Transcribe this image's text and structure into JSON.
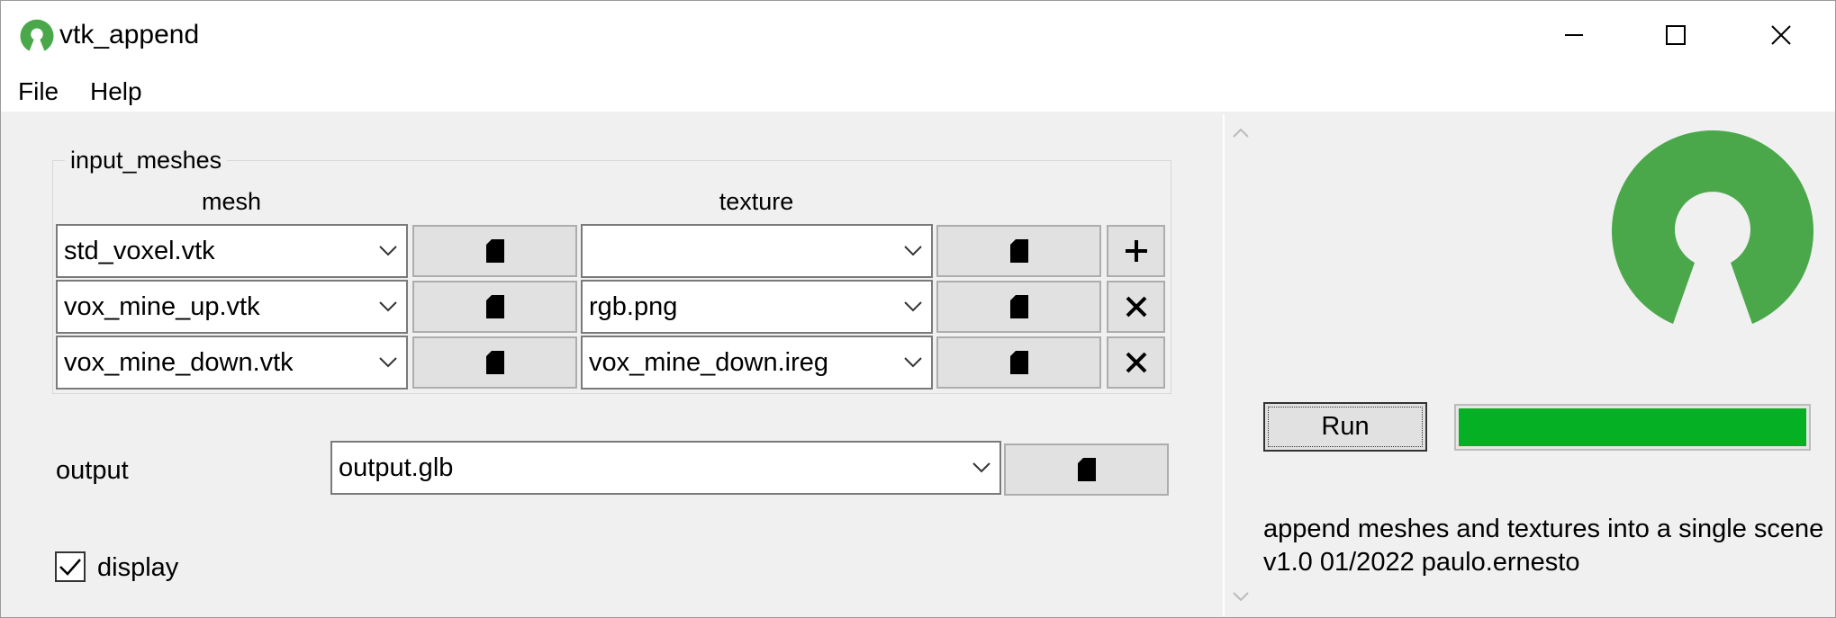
{
  "window": {
    "title": "vtk_append",
    "minimize_icon": "minimize-icon",
    "maximize_icon": "maximize-icon",
    "close_icon": "close-icon"
  },
  "menu": [
    {
      "label": "File"
    },
    {
      "label": "Help"
    }
  ],
  "input_meshes": {
    "title": "input_meshes",
    "mesh_header": "mesh",
    "texture_header": "texture",
    "rows": [
      {
        "mesh": "std_voxel.vtk",
        "texture": "",
        "action_icon": "plus-icon"
      },
      {
        "mesh": "vox_mine_up.vtk",
        "texture": "rgb.png",
        "action_icon": "x-icon"
      },
      {
        "mesh": "vox_mine_down.vtk",
        "texture": "vox_mine_down.ireg",
        "action_icon": "x-icon"
      }
    ]
  },
  "output": {
    "label": "output",
    "value": "output.glb"
  },
  "display": {
    "label": "display",
    "checked": true
  },
  "run": {
    "label": "Run",
    "progress": 1.0
  },
  "about": {
    "line1": "append meshes and textures into a single scene",
    "line2": "v1.0 01/2022 paulo.ernesto"
  },
  "colors": {
    "logo_green": "#4aa84a",
    "progress_green": "#06b025",
    "panel_bg": "#f0f0f0"
  }
}
